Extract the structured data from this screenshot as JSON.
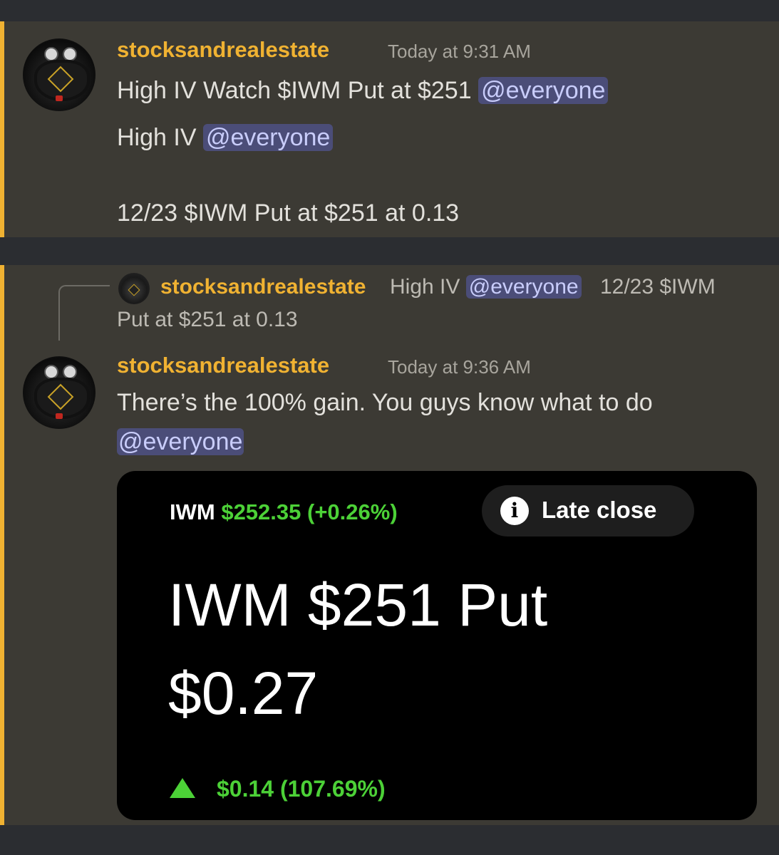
{
  "message1": {
    "username": "stocksandrealestate",
    "timestamp": "Today at 9:31 AM",
    "line1": "High IV Watch $IWM Put at $251",
    "line1_mention": "@everyone",
    "line2": "High IV",
    "line2_mention": "@everyone",
    "line3": "12/23 $IWM Put at $251 at 0.13"
  },
  "reply": {
    "username": "stocksandrealestate",
    "text_before": "High IV",
    "mention": "@everyone",
    "text_after": "12/23 $IWM",
    "text_line2": "Put at $251 at 0.13"
  },
  "message2": {
    "username": "stocksandrealestate",
    "timestamp": "Today at 9:36 AM",
    "line1": "There’s the 100% gain. You guys know what to do",
    "mention": "@everyone"
  },
  "card": {
    "ticker": "IWM",
    "ticker_price": "$252.35 (+0.26%)",
    "status_icon": "info-icon",
    "status_label": "Late close",
    "option_name": "IWM $251 Put",
    "option_price": "$0.27",
    "change": "$0.14 (107.69%)",
    "change_icon": "up-triangle-icon"
  },
  "colors": {
    "accent_bar": "#f0b232",
    "username": "#f0b232",
    "mention_bg": "#4b4d78",
    "gain_green": "#4cd137",
    "card_bg": "#000000"
  }
}
